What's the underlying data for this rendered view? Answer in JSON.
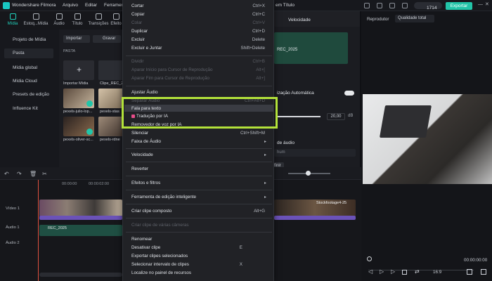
{
  "app": {
    "name": "Wondershare Filmora",
    "menus": [
      "Arquivo",
      "Editar",
      "Ferramen"
    ],
    "project_title": "em Título",
    "credits": "1714",
    "export_label": "Exportar"
  },
  "tabs": [
    "Mídia",
    "Estoq...Mídia",
    "Áudio",
    "Título",
    "Transições",
    "Efeito"
  ],
  "sidebar": {
    "items": [
      "Projeto de Mídia",
      "Pasta",
      "Mídia global",
      "Mídia Cloud",
      "Presets de edição",
      "Influence Kit"
    ]
  },
  "media": {
    "import_label": "Importar",
    "save_label": "Gravar",
    "folder_label": "PASTA",
    "import_media_label": "Importar Mídia",
    "items": [
      "Clipe_REC_2",
      "pexels-julio-lop...",
      "pexels-stas",
      "pexels-oliver-sc...",
      "pexels-rdne"
    ]
  },
  "context_menu": {
    "items": [
      {
        "label": "Cortar",
        "shortcut": "Ctrl+X",
        "disabled": false
      },
      {
        "label": "Copiar",
        "shortcut": "Ctrl+C",
        "disabled": false
      },
      {
        "label": "Colar",
        "shortcut": "Ctrl+V",
        "disabled": true
      },
      {
        "label": "Duplicar",
        "shortcut": "Ctrl+D",
        "disabled": false
      },
      {
        "label": "Excluir",
        "shortcut": "Delete",
        "disabled": false
      },
      {
        "label": "Excluir e Juntar",
        "shortcut": "Shift+Delete",
        "disabled": false
      },
      {
        "label": "Dividir",
        "shortcut": "Ctrl+B",
        "disabled": true
      },
      {
        "label": "Aparar Início para Cursor de Reprodução",
        "shortcut": "Alt+[",
        "disabled": true
      },
      {
        "label": "Aparar Fim para Cursor de Reprodução",
        "shortcut": "Alt+]",
        "disabled": true
      },
      {
        "label": "Ajustar Áudio",
        "shortcut": "",
        "disabled": false
      },
      {
        "label": "Separar Áudio",
        "shortcut": "Ctrl+Alt+D",
        "disabled": true
      },
      {
        "label": "Fala para texto",
        "shortcut": "",
        "disabled": false
      },
      {
        "label": "Tradução por IA",
        "shortcut": "",
        "disabled": false
      },
      {
        "label": "Removedor de voz por IA",
        "shortcut": "",
        "disabled": false
      },
      {
        "label": "Silenciar",
        "shortcut": "Ctrl+Shift+M",
        "disabled": false
      },
      {
        "label": "Faixa de Áudio",
        "shortcut": "",
        "disabled": false
      },
      {
        "label": "Velocidade",
        "shortcut": "",
        "disabled": false
      },
      {
        "label": "Reverter",
        "shortcut": "",
        "disabled": false
      },
      {
        "label": "Efeitos e filtros",
        "shortcut": "",
        "disabled": false
      },
      {
        "label": "Ferramenta de edição inteligente",
        "shortcut": "",
        "disabled": false
      },
      {
        "label": "Criar clipe composto",
        "shortcut": "Alt+G",
        "disabled": false
      },
      {
        "label": "Criar clipe de várias câmeras",
        "shortcut": "",
        "disabled": true
      },
      {
        "label": "Renomear",
        "shortcut": "",
        "disabled": false
      },
      {
        "label": "Desativar clipe",
        "shortcut": "E",
        "disabled": false
      },
      {
        "label": "Exportar clipes selecionados",
        "shortcut": "",
        "disabled": false
      },
      {
        "label": "Selecionar intervalo de clipes",
        "shortcut": "X",
        "disabled": false
      },
      {
        "label": "Localize no painel de recursos",
        "shortcut": "",
        "disabled": false
      }
    ]
  },
  "properties": {
    "tab_video": "Velocidade",
    "clip_name": "REC_2025",
    "auto_label": "ização Automática",
    "volume_value": "20,00",
    "volume_unit": "dB",
    "audio_label": "de áudio",
    "dropdown_value": "hum",
    "apply_label": "finir"
  },
  "player": {
    "label": "Reprodutor",
    "quality": "Qualidade total",
    "timecode": "00:00:00:00",
    "aspect": "16:9"
  },
  "timeline": {
    "tracks": [
      "Vídeo 1",
      "Áudio 1",
      "Áudio 2"
    ],
    "audio_clip": "REC_2025",
    "video_clip_right": "Stockfootage4-25",
    "time_marks": [
      "00:00:00",
      "00:00:01:00",
      "00:00:02:00"
    ]
  }
}
